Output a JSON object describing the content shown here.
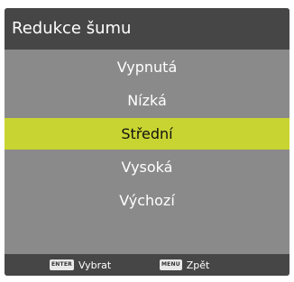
{
  "header": {
    "title": "Redukce šumu"
  },
  "menu": {
    "items": [
      {
        "label": "Vypnutá"
      },
      {
        "label": "Nízká"
      },
      {
        "label": "Střední"
      },
      {
        "label": "Vysoká"
      },
      {
        "label": "Výchozí"
      }
    ],
    "selected_index": 2
  },
  "footer": {
    "enter": {
      "key": "ENTER",
      "label": "Vybrat"
    },
    "menu": {
      "key": "MENU",
      "label": "Zpět"
    }
  },
  "colors": {
    "header_bg": "#464646",
    "panel_bg": "#8a8a8a",
    "selected_bg": "#c8d431"
  }
}
